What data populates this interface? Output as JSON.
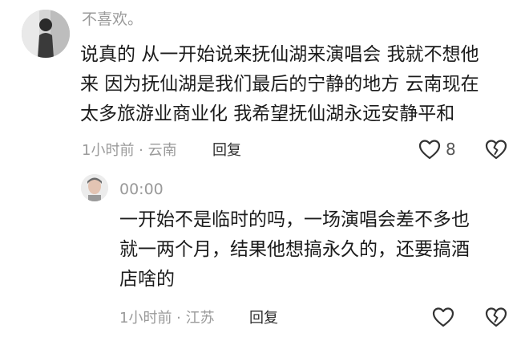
{
  "comments": [
    {
      "username": "不喜欢。",
      "lines": [
        "说真的 从一开始说来抚仙湖来演唱会 我就不想他",
        "来 因为抚仙湖是我们最后的宁静的地方 云南现在",
        "太多旅游业商业化 我希望抚仙湖永远安静平和"
      ],
      "meta": "1小时前 · 云南",
      "reply_label": "回复",
      "like_count": "8"
    },
    {
      "username": "00:00",
      "lines": [
        "一开始不是临时的吗，一场演唱会差不多也",
        "就一两个月，结果他想搞永久的，还要搞酒",
        "店啥的"
      ],
      "meta": "1小时前 · 江苏",
      "reply_label": "回复",
      "like_count": ""
    }
  ],
  "icons": {
    "like": "heart-outline-icon",
    "dislike": "broken-heart-icon"
  },
  "colors": {
    "username": "#9a9a9a",
    "body": "#1b1b1b",
    "meta": "#9a9a9a",
    "icon": "#333333"
  }
}
